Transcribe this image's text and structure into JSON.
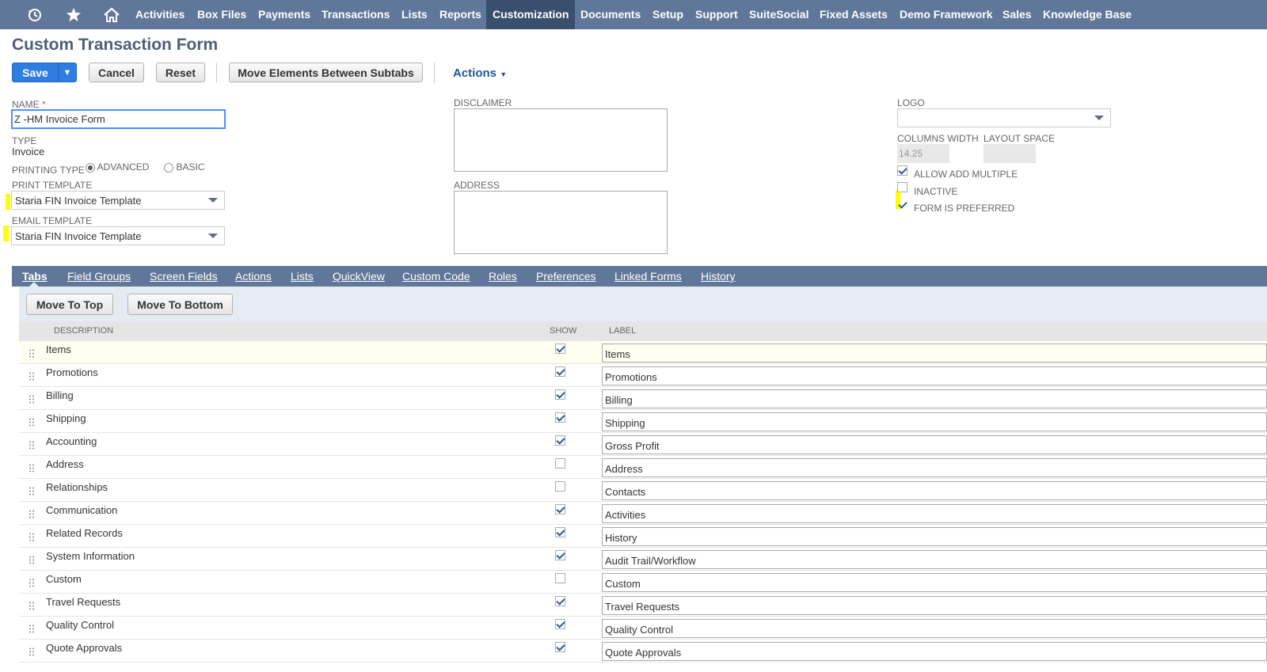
{
  "nav": {
    "items": [
      "Activities",
      "Box Files",
      "Payments",
      "Transactions",
      "Lists",
      "Reports",
      "Customization",
      "Documents",
      "Setup",
      "Support",
      "SuiteSocial",
      "Fixed Assets",
      "Demo Framework",
      "Sales",
      "Knowledge Base"
    ],
    "active": "Customization"
  },
  "page": {
    "title": "Custom Transaction Form"
  },
  "toolbar": {
    "save": "Save",
    "cancel": "Cancel",
    "reset": "Reset",
    "move_elements": "Move Elements Between Subtabs",
    "actions": "Actions"
  },
  "form": {
    "name_label": "NAME",
    "name_required": "*",
    "name_value": "Z -HM Invoice Form",
    "type_label": "TYPE",
    "type_value": "Invoice",
    "printing_type_label": "PRINTING TYPE",
    "printing_advanced": "ADVANCED",
    "printing_basic": "BASIC",
    "print_template_label": "PRINT TEMPLATE",
    "print_template_value": "Staria FIN Invoice Template",
    "email_template_label": "EMAIL TEMPLATE",
    "email_template_value": "Staria FIN Invoice Template",
    "disclaimer_label": "DISCLAIMER",
    "address_label": "ADDRESS",
    "logo_label": "LOGO",
    "columns_width_label": "COLUMNS WIDTH",
    "columns_width_value": "14.25",
    "layout_space_label": "LAYOUT SPACE",
    "allow_add_multiple": "ALLOW ADD MULTIPLE",
    "inactive": "INACTIVE",
    "form_is_preferred": "FORM IS PREFERRED"
  },
  "subtabs": [
    "Tabs",
    "Field Groups",
    "Screen Fields",
    "Actions",
    "Lists",
    "QuickView",
    "Custom Code",
    "Roles",
    "Preferences",
    "Linked Forms",
    "History"
  ],
  "panel": {
    "move_top": "Move To Top",
    "move_bottom": "Move To Bottom",
    "col_description": "DESCRIPTION",
    "col_show": "SHOW",
    "col_label": "LABEL"
  },
  "rows": [
    {
      "description": "Items",
      "show": true,
      "label": "Items"
    },
    {
      "description": "Promotions",
      "show": true,
      "label": "Promotions"
    },
    {
      "description": "Billing",
      "show": true,
      "label": "Billing"
    },
    {
      "description": "Shipping",
      "show": true,
      "label": "Shipping"
    },
    {
      "description": "Accounting",
      "show": true,
      "label": "Gross Profit"
    },
    {
      "description": "Address",
      "show": false,
      "label": "Address"
    },
    {
      "description": "Relationships",
      "show": false,
      "label": "Contacts"
    },
    {
      "description": "Communication",
      "show": true,
      "label": "Activities"
    },
    {
      "description": "Related Records",
      "show": true,
      "label": "History"
    },
    {
      "description": "System Information",
      "show": true,
      "label": "Audit Trail/Workflow"
    },
    {
      "description": "Custom",
      "show": false,
      "label": "Custom"
    },
    {
      "description": "Travel Requests",
      "show": true,
      "label": "Travel Requests"
    },
    {
      "description": "Quality Control",
      "show": true,
      "label": "Quality Control"
    },
    {
      "description": "Quote Approvals",
      "show": true,
      "label": "Quote Approvals"
    }
  ]
}
